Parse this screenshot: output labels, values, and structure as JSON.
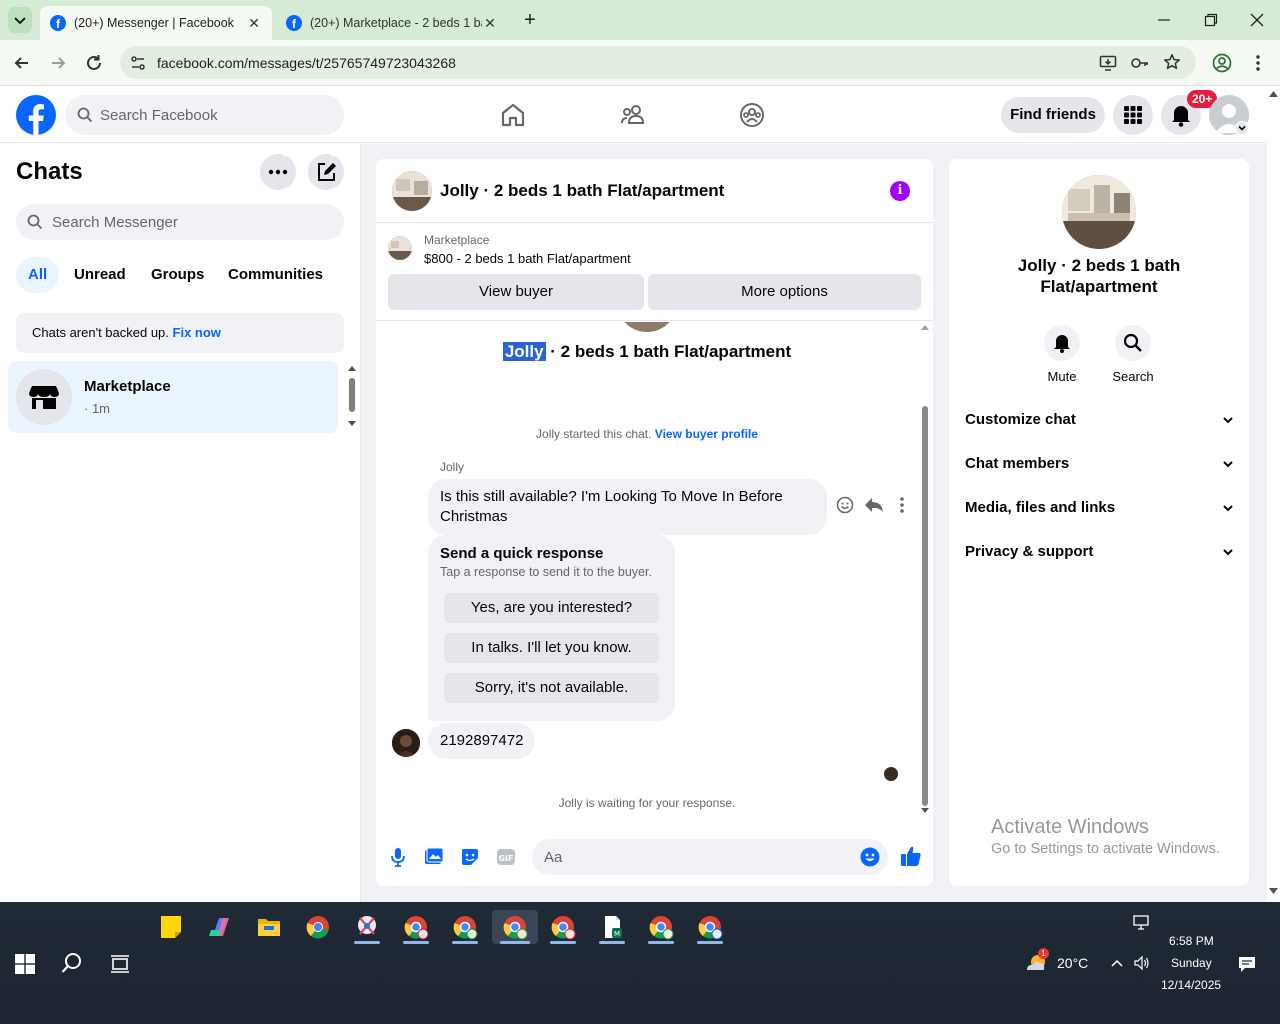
{
  "browser": {
    "tabs": [
      {
        "title": "(20+) Messenger | Facebook",
        "active": true
      },
      {
        "title": "(20+) Marketplace - 2 beds 1 ba",
        "active": false
      }
    ],
    "url": "facebook.com/messages/t/25765749723043268",
    "new_tab_symbol": "+"
  },
  "header": {
    "search_placeholder": "Search Facebook",
    "find_friends": "Find friends",
    "notif_badge": "20+",
    "brand_color": "#0866ff"
  },
  "left": {
    "title": "Chats",
    "search_placeholder": "Search Messenger",
    "filters": [
      "All",
      "Unread",
      "Groups",
      "Communities"
    ],
    "backup_text": "Chats aren't backed up.",
    "backup_link": "Fix now",
    "chat_item": {
      "name": "Marketplace",
      "time": "· 1m"
    }
  },
  "chat": {
    "title": "Jolly · 2 beds 1 bath Flat/apartment",
    "marketplace_label": "Marketplace",
    "listing_price": "$800 - 2 beds 1 bath Flat/apartment",
    "view_buyer": "View buyer",
    "more_options": "More options",
    "big_title_highlight": "Jolly",
    "big_title_rest": " · 2 beds 1 bath Flat/apartment",
    "started_text": "Jolly started this chat.",
    "started_link": "View buyer profile",
    "sender_name": "Jolly",
    "message1": "Is this still available? I'm Looking To Move In Before Christmas",
    "quick_title": "Send a quick response",
    "quick_sub": "Tap a response to send it to the buyer.",
    "quick_options": [
      "Yes, are you interested?",
      "In talks. I'll let you know.",
      "Sorry, it's not available."
    ],
    "message2": "2192897472",
    "waiting": "Jolly is waiting for your response.",
    "composer_placeholder": "Aa"
  },
  "right": {
    "title": "Jolly · 2 beds 1 bath Flat/apartment",
    "actions": [
      "Mute",
      "Search"
    ],
    "sections": [
      "Customize chat",
      "Chat members",
      "Media, files and links",
      "Privacy & support"
    ],
    "watermark_title": "Activate Windows",
    "watermark_sub": "Go to Settings to activate Windows."
  },
  "taskbar": {
    "weather": "20°C",
    "weather_badge": "1",
    "time": "6:58 PM",
    "day": "Sunday",
    "date": "12/14/2025"
  }
}
